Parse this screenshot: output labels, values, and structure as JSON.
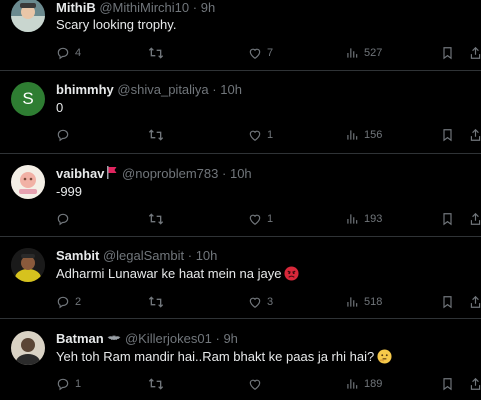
{
  "tweets": [
    {
      "name": "MithiB",
      "handle": "@MithiMirchi10",
      "time": "9h",
      "text": "Scary looking trophy.",
      "replies": "4",
      "reposts": "",
      "likes": "7",
      "views": "527"
    },
    {
      "name": "bhimmhy",
      "handle": "@shiva_pitaliya",
      "time": "10h",
      "avatar_letter": "S",
      "text": "0",
      "replies": "",
      "reposts": "",
      "likes": "1",
      "views": "156"
    },
    {
      "name": "vaibhav",
      "handle": "@noproblem783",
      "time": "10h",
      "text": "-999",
      "replies": "",
      "reposts": "",
      "likes": "1",
      "views": "193"
    },
    {
      "name": "Sambit",
      "handle": "@legalSambit",
      "time": "10h",
      "text": "Adharmi Lunawar ke haat mein na jaye",
      "replies": "2",
      "reposts": "",
      "likes": "3",
      "views": "518"
    },
    {
      "name": "Batman",
      "handle": "@Killerjokes01",
      "time": "9h",
      "text": "Yeh toh Ram mandir hai..Ram bhakt ke paas ja rhi hai?",
      "replies": "1",
      "reposts": "",
      "likes": "",
      "views": "189"
    }
  ],
  "separator": "·",
  "colors": {
    "background": "#000000",
    "text": "#e7e9ea",
    "muted": "#71767b",
    "divider": "#2f3336",
    "avatar_s": "#2e7d32"
  },
  "icons": {
    "reply": "reply-icon",
    "repost": "repost-icon",
    "like": "heart-icon",
    "views": "views-icon",
    "bookmark": "bookmark-icon",
    "share": "share-icon"
  }
}
